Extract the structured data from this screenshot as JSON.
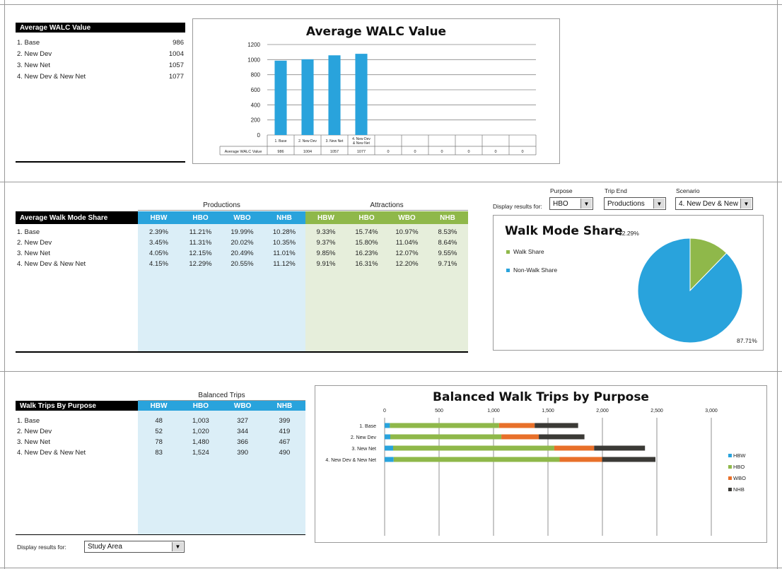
{
  "colors": {
    "blue": "#29a3dc",
    "green": "#8fb84a",
    "orange": "#e8702a",
    "dark": "#3b3a36",
    "light_blue_bg": "#dbeef7",
    "light_green_bg": "#e6eedb"
  },
  "walc": {
    "header": "Average WALC Value",
    "rows": [
      {
        "label": "1. Base",
        "value": "986"
      },
      {
        "label": "2. New Dev",
        "value": "1004"
      },
      {
        "label": "3. New Net",
        "value": "1057"
      },
      {
        "label": "4. New Dev & New Net",
        "value": "1077"
      }
    ]
  },
  "chart_walc": {
    "title": "Average WALC Value",
    "yticks": [
      "1200",
      "1000",
      "800",
      "600",
      "400",
      "200",
      "0"
    ],
    "table_row_label": "Average WALC Value",
    "table_values": [
      "986",
      "1004",
      "1057",
      "1077",
      "0",
      "0",
      "0",
      "0",
      "0",
      "0"
    ],
    "category_labels": [
      "1. Base",
      "2. New Dev",
      "3. New Net",
      "4. New Dev & New Net",
      "",
      "",
      "",
      "",
      "",
      ""
    ]
  },
  "mode_share": {
    "header": "Average Walk Mode Share",
    "productions_label": "Productions",
    "attractions_label": "Attractions",
    "columns": [
      "HBW",
      "HBO",
      "WBO",
      "NHB",
      "HBW",
      "HBO",
      "WBO",
      "NHB"
    ],
    "rows": [
      {
        "label": "1. Base",
        "values": [
          "2.39%",
          "11.21%",
          "19.99%",
          "10.28%",
          "9.33%",
          "15.74%",
          "10.97%",
          "8.53%"
        ]
      },
      {
        "label": "2. New Dev",
        "values": [
          "3.45%",
          "11.31%",
          "20.02%",
          "10.35%",
          "9.37%",
          "15.80%",
          "11.04%",
          "8.64%"
        ]
      },
      {
        "label": "3. New Net",
        "values": [
          "4.05%",
          "12.15%",
          "20.49%",
          "11.01%",
          "9.85%",
          "16.23%",
          "12.07%",
          "9.55%"
        ]
      },
      {
        "label": "4. New Dev & New Net",
        "values": [
          "4.15%",
          "12.29%",
          "20.55%",
          "11.12%",
          "9.91%",
          "16.31%",
          "12.20%",
          "9.71%"
        ]
      }
    ]
  },
  "filters": {
    "display_label": "Display results for:",
    "purpose_label": "Purpose",
    "purpose_value": "HBO",
    "trip_end_label": "Trip End",
    "trip_end_value": "Productions",
    "scenario_label": "Scenario",
    "scenario_value": "4. New Dev & New"
  },
  "pie": {
    "title": "Walk Mode Share",
    "legend": [
      "Walk Share",
      "Non-Walk Share"
    ],
    "walk_label": "12.29%",
    "nonwalk_label": "87.71%"
  },
  "trips": {
    "header": "Walk Trips By Purpose",
    "group_label": "Balanced Trips",
    "columns": [
      "HBW",
      "HBO",
      "WBO",
      "NHB"
    ],
    "rows": [
      {
        "label": "1. Base",
        "values": [
          "48",
          "1,003",
          "327",
          "399"
        ]
      },
      {
        "label": "2. New Dev",
        "values": [
          "52",
          "1,020",
          "344",
          "419"
        ]
      },
      {
        "label": "3. New Net",
        "values": [
          "78",
          "1,480",
          "366",
          "467"
        ]
      },
      {
        "label": "4. New Dev & New Net",
        "values": [
          "83",
          "1,524",
          "390",
          "490"
        ]
      }
    ],
    "display_label": "Display results for:",
    "display_value": "Study Area"
  },
  "chart_trips": {
    "title": "Balanced Walk Trips by Purpose",
    "xticks": [
      "0",
      "500",
      "1,000",
      "1,500",
      "2,000",
      "2,500",
      "3,000"
    ],
    "legend": [
      "HBW",
      "HBO",
      "WBO",
      "NHB"
    ]
  },
  "chart_data": [
    {
      "type": "bar",
      "title": "Average WALC Value",
      "categories": [
        "1. Base",
        "2. New Dev",
        "3. New Net",
        "4. New Dev & New Net"
      ],
      "values": [
        986,
        1004,
        1057,
        1077
      ],
      "ylim": [
        0,
        1200
      ]
    },
    {
      "type": "pie",
      "title": "Walk Mode Share",
      "categories": [
        "Walk Share",
        "Non-Walk Share"
      ],
      "values": [
        12.29,
        87.71
      ]
    },
    {
      "type": "bar",
      "orientation": "horizontal-stacked",
      "title": "Balanced Walk Trips by Purpose",
      "categories": [
        "1. Base",
        "2. New Dev",
        "3. New Net",
        "4. New Dev & New Net"
      ],
      "series": [
        {
          "name": "HBW",
          "values": [
            48,
            52,
            78,
            83
          ]
        },
        {
          "name": "HBO",
          "values": [
            1003,
            1020,
            1480,
            1524
          ]
        },
        {
          "name": "WBO",
          "values": [
            327,
            344,
            366,
            390
          ]
        },
        {
          "name": "NHB",
          "values": [
            399,
            419,
            467,
            490
          ]
        }
      ],
      "xlim": [
        0,
        3000
      ]
    }
  ]
}
